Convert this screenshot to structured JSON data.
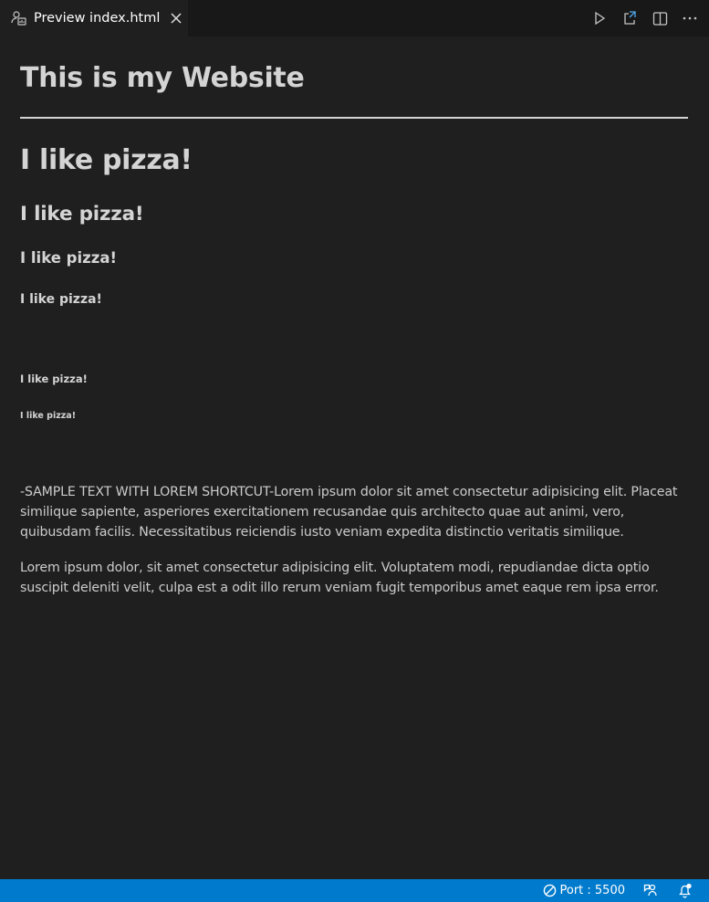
{
  "tab": {
    "label": "Preview index.html",
    "icon": "preview-icon",
    "close_icon": "close-icon"
  },
  "editor_actions": [
    "run-icon",
    "open-in-browser-icon",
    "split-editor-icon",
    "more-actions-icon"
  ],
  "page": {
    "site_title": "This is my Website",
    "headings": [
      "I like pizza!",
      "I like pizza!",
      "I like pizza!",
      "I like pizza!",
      "I like pizza!",
      "I like pizza!"
    ],
    "paragraphs": [
      "-SAMPLE TEXT WITH LOREM SHORTCUT-Lorem ipsum dolor sit amet consectetur adipisicing elit. Placeat similique sapiente, asperiores exercitationem recusandae quis architecto quae aut animi, vero, quibusdam facilis. Necessitatibus reiciendis iusto veniam expedita distinctio veritatis similique.",
      "Lorem ipsum dolor, sit amet consectetur adipisicing elit. Voluptatem modi, repudiandae dicta optio suscipit deleniti velit, culpa est a odit illo rerum veniam fugit temporibus amet eaque rem ipsa error."
    ]
  },
  "statusbar": {
    "port_label": "Port : 5500",
    "port_icon": "port-disabled-icon",
    "icons": [
      "feedback-icon",
      "notifications-icon"
    ],
    "color": "#007acc"
  },
  "colors": {
    "background": "#1f1f1f",
    "tabbar": "#181818",
    "text": "#cccccc"
  }
}
